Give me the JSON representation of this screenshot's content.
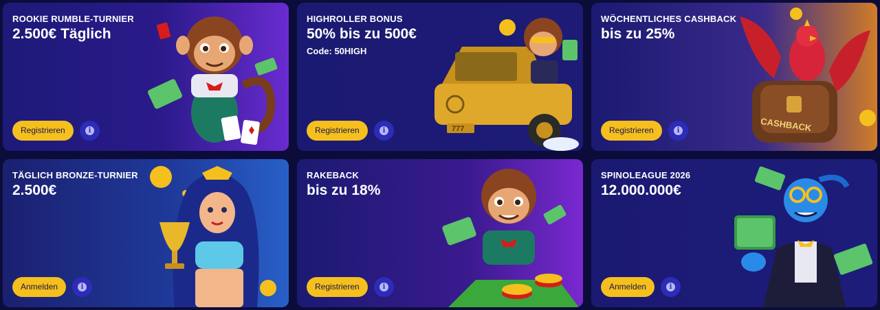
{
  "promotions": [
    {
      "title": "ROOKIE RUMBLE-TURNIER",
      "headline": "2.500€ Täglich",
      "code": "",
      "button_label": "Registrieren",
      "info_symbol": "i",
      "art_icon": "monkey-with-cards-illustration"
    },
    {
      "title": "HIGHROLLER BONUS",
      "headline": "50% bis zu 500€",
      "code": "Code: 50HIGH",
      "button_label": "Registrieren",
      "info_symbol": "i",
      "art_icon": "monkey-in-gold-car-illustration",
      "car_plate": "777"
    },
    {
      "title": "WÖCHENTLICHES CASHBACK",
      "headline": "bis zu 25%",
      "code": "",
      "button_label": "Registrieren",
      "info_symbol": "i",
      "art_icon": "phoenix-with-cashback-bag-illustration",
      "bag_label": "CASHBACK"
    },
    {
      "title": "TÄGLICH BRONZE-TURNIER",
      "headline": "2.500€",
      "code": "",
      "button_label": "Anmelden",
      "info_symbol": "i",
      "art_icon": "princess-with-trophy-illustration"
    },
    {
      "title": "RAKEBACK",
      "headline": "bis zu 18%",
      "code": "",
      "button_label": "Registrieren",
      "info_symbol": "i",
      "art_icon": "monkey-with-chips-illustration"
    },
    {
      "title": "SPINOLEAGUE 2026",
      "headline": "12.000.000€",
      "code": "",
      "button_label": "Anmelden",
      "info_symbol": "i",
      "art_icon": "genie-with-money-illustration"
    }
  ],
  "colors": {
    "page_bg": "#0c0c3a",
    "card_bg": "#1b1a72",
    "button_bg": "#f5c01e",
    "button_text": "#1a1447",
    "info_bg": "#2c2cb8"
  }
}
